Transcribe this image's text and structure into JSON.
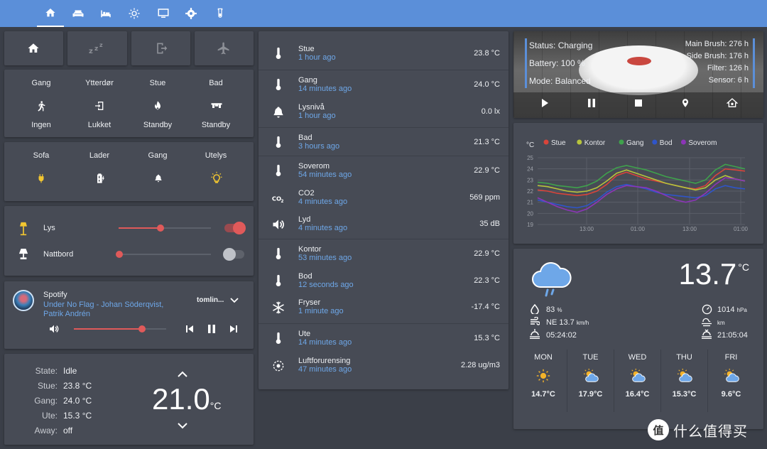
{
  "tabs": [
    "home-icon",
    "sofa-icon",
    "bed-icon",
    "sun-icon",
    "monitor-icon",
    "gear-icon",
    "flask-icon"
  ],
  "scenes": [
    "home-icon",
    "sleep-icon",
    "exit-icon",
    "airplane-icon"
  ],
  "alarms": {
    "items": [
      {
        "name": "Gang",
        "icon": "walk-icon",
        "state": "Ingen"
      },
      {
        "name": "Ytterdør",
        "icon": "door-enter-icon",
        "state": "Lukket"
      },
      {
        "name": "Stue",
        "icon": "flame-icon",
        "state": "Standby"
      },
      {
        "name": "Bad",
        "icon": "towel-icon",
        "state": "Standby"
      }
    ]
  },
  "switches": [
    {
      "name": "Sofa",
      "icon": "plug-icon"
    },
    {
      "name": "Lader",
      "icon": "battery-charge-icon"
    },
    {
      "name": "Gang",
      "icon": "bell-icon"
    },
    {
      "name": "Utelys",
      "icon": "bulb-icon"
    }
  ],
  "lights": [
    {
      "name": "Lys",
      "icon": "floor-lamp-icon",
      "level": 0.45,
      "on": true
    },
    {
      "name": "Nattbord",
      "icon": "table-lamp-icon",
      "level": 0.0,
      "on": false
    }
  ],
  "media": {
    "source": "Spotify",
    "title": "Under No Flag - Johan Söderqvist, Patrik Andrén",
    "device": "tomlin...",
    "volume": 0.74
  },
  "thermostat": {
    "rows": [
      {
        "k": "State:",
        "v": "Idle"
      },
      {
        "k": "Stue:",
        "v": "23.8 °C"
      },
      {
        "k": "Gang:",
        "v": "24.0 °C"
      },
      {
        "k": "Ute:",
        "v": "15.3 °C"
      },
      {
        "k": "Away:",
        "v": "off"
      }
    ],
    "target": "21.0",
    "unit": "°C"
  },
  "sensors": [
    {
      "group": 1,
      "name": "Stue",
      "time": "1 hour ago",
      "value": "23.8 °C",
      "icon": "thermometer-icon"
    },
    {
      "group": 2,
      "name": "Gang",
      "time": "14 minutes ago",
      "value": "24.0 °C",
      "icon": "thermometer-icon"
    },
    {
      "group": 2,
      "name": "Lysnivå",
      "time": "1 hour ago",
      "value": "0.0 lx",
      "icon": "bell-icon"
    },
    {
      "group": 3,
      "name": "Bad",
      "time": "3 hours ago",
      "value": "21.3 °C",
      "icon": "thermometer-icon"
    },
    {
      "group": 4,
      "name": "Soverom",
      "time": "54 minutes ago",
      "value": "22.9 °C",
      "icon": "thermometer-icon"
    },
    {
      "group": 4,
      "name": "CO2",
      "time": "4 minutes ago",
      "value": "569 ppm",
      "icon": "co2-icon"
    },
    {
      "group": 4,
      "name": "Lyd",
      "time": "4 minutes ago",
      "value": "35 dB",
      "icon": "speaker-icon"
    },
    {
      "group": 5,
      "name": "Kontor",
      "time": "53 minutes ago",
      "value": "22.9 °C",
      "icon": "thermometer-icon"
    },
    {
      "group": 5,
      "name": "Bod",
      "time": "12 seconds ago",
      "value": "22.3 °C",
      "icon": "thermometer-icon"
    },
    {
      "group": 5,
      "name": "Fryser",
      "time": "1 minute ago",
      "value": "-17.4 °C",
      "icon": "snowflake-icon"
    },
    {
      "group": 6,
      "name": "Ute",
      "time": "14 minutes ago",
      "value": "15.3 °C",
      "icon": "thermometer-icon"
    },
    {
      "group": 6,
      "name": "Luftforurensing",
      "time": "47 minutes ago",
      "value": "2.28 ug/m3",
      "icon": "air-filter-icon"
    }
  ],
  "vacuum": {
    "status": "Status: Charging",
    "battery": "Battery: 100 %",
    "mode": "Mode: Balanced",
    "main_brush": "Main Brush: 276 h",
    "side_brush": "Side Brush: 176 h",
    "filter": "Filter: 126 h",
    "sensor": "Sensor: 6 h"
  },
  "chart_data": {
    "type": "line",
    "ylabel": "°C",
    "x": [
      "13:00",
      "01:00",
      "13:00",
      "01:00"
    ],
    "ylim": [
      19,
      25
    ],
    "yticks": [
      19,
      20,
      21,
      22,
      23,
      24,
      25
    ],
    "grid": true,
    "legend": "top",
    "series": [
      {
        "name": "Stue",
        "color": "#d9443a",
        "values": [
          22.1,
          22.0,
          21.8,
          21.7,
          21.6,
          21.7,
          22.0,
          22.6,
          23.4,
          23.7,
          23.4,
          23.1,
          22.9,
          22.7,
          22.5,
          22.3,
          22.2,
          22.5,
          23.4,
          24.0,
          23.9,
          23.8
        ]
      },
      {
        "name": "Kontor",
        "color": "#b7c43c",
        "values": [
          22.5,
          22.4,
          22.2,
          22.0,
          21.9,
          22.0,
          22.3,
          22.9,
          23.6,
          23.9,
          23.6,
          23.3,
          23.0,
          22.7,
          22.5,
          22.3,
          22.1,
          22.3,
          23.0,
          23.4,
          23.1,
          22.9
        ]
      },
      {
        "name": "Gang",
        "color": "#3fa24c",
        "values": [
          22.8,
          22.7,
          22.5,
          22.4,
          22.3,
          22.5,
          22.9,
          23.6,
          24.1,
          24.3,
          24.1,
          23.9,
          23.6,
          23.3,
          23.1,
          22.9,
          22.7,
          23.0,
          23.9,
          24.4,
          24.2,
          24.0
        ]
      },
      {
        "name": "Bod",
        "color": "#2f55c9",
        "values": [
          21.2,
          21.0,
          20.8,
          20.6,
          20.5,
          20.7,
          21.2,
          21.9,
          22.4,
          22.6,
          22.4,
          22.2,
          21.9,
          21.7,
          21.6,
          21.5,
          21.4,
          21.6,
          22.2,
          22.5,
          22.3,
          22.2
        ]
      },
      {
        "name": "Soverom",
        "color": "#8c35b8",
        "values": [
          21.4,
          21.0,
          20.6,
          20.3,
          20.1,
          20.4,
          21.0,
          21.7,
          22.2,
          22.5,
          22.4,
          22.3,
          22.0,
          21.6,
          21.2,
          21.0,
          21.2,
          21.8,
          22.6,
          23.2,
          23.1,
          22.9
        ]
      }
    ]
  },
  "weather": {
    "temp": "13.7",
    "unit": "°C",
    "humidity": "83",
    "humidity_unit": "%",
    "wind": "NE 13.7",
    "wind_unit": "km/h",
    "sunrise": "05:24:02",
    "pressure": "1014",
    "pressure_unit": "hPa",
    "visibility_unit": "km",
    "sunset": "21:05:04",
    "forecast": [
      {
        "day": "MON",
        "icon": "sun-icon",
        "temp": "14.7°C"
      },
      {
        "day": "TUE",
        "icon": "partly-cloudy-icon",
        "temp": "17.9°C"
      },
      {
        "day": "WED",
        "icon": "partly-cloudy-icon",
        "temp": "16.4°C"
      },
      {
        "day": "THU",
        "icon": "partly-cloudy-icon",
        "temp": "15.3°C"
      },
      {
        "day": "FRI",
        "icon": "partly-cloudy-icon",
        "temp": "9.6°C"
      }
    ]
  },
  "watermark": "值 什么值得买"
}
